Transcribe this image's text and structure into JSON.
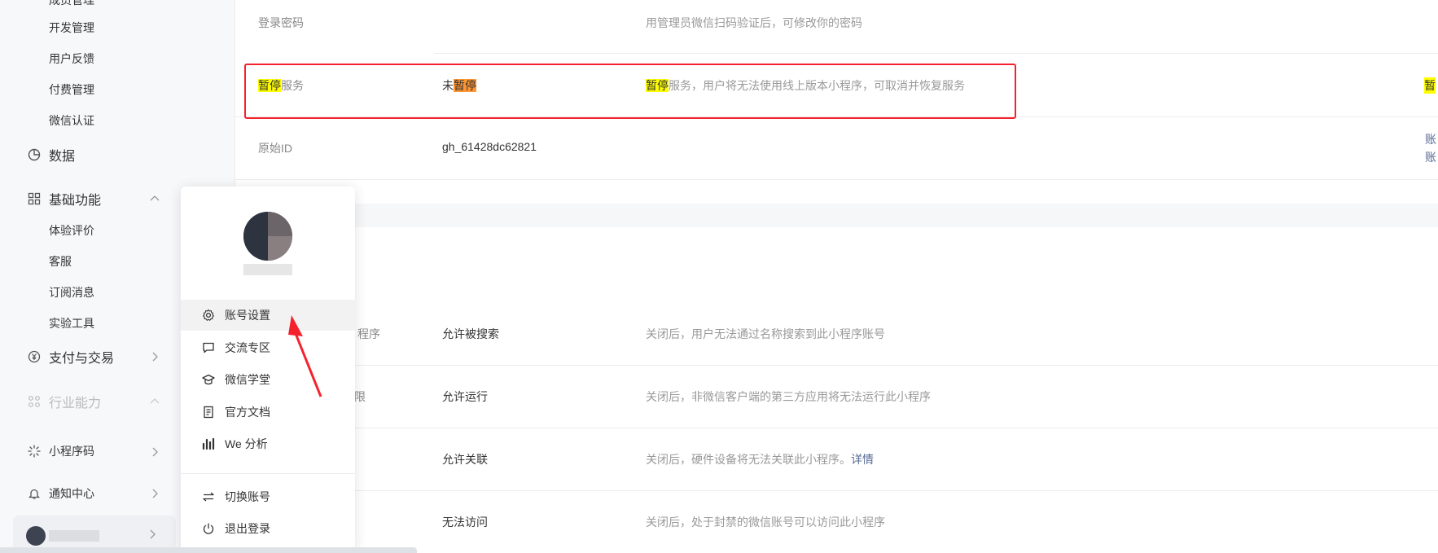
{
  "sidebar": {
    "partial_top_label": "成员管理",
    "sub_items_top": [
      "开发管理",
      "用户反馈",
      "付费管理",
      "微信认证"
    ],
    "data_section": {
      "label": "数据",
      "icon": "pie-chart-icon"
    },
    "basic_section": {
      "label": "基础功能",
      "icon": "grid-icon",
      "expanded": true
    },
    "basic_items": [
      "体验评价",
      "客服",
      "订阅消息",
      "实验工具"
    ],
    "pay_section": {
      "label": "支付与交易",
      "icon": "yuan-icon"
    },
    "industry_section": {
      "label": "行业能力",
      "icon": "nodes-icon"
    },
    "qrcode_section": {
      "label": "小程序码",
      "icon": "sparkle-icon"
    },
    "notify_section": {
      "label": "通知中心",
      "icon": "bell-icon"
    }
  },
  "rows": {
    "password": {
      "label": "登录密码",
      "desc": "用管理员微信扫码验证后，可修改你的密码"
    },
    "pause": {
      "label_hl": "暂停",
      "label_rest": "服务",
      "value_prefix": "未",
      "value_hl": "暂停",
      "desc_hl": "暂停",
      "desc_rest": "服务，用户将无法使用线上版本小程序，可取消并恢复服务",
      "right_hl": "暂"
    },
    "original_id": {
      "label": "原始ID",
      "value": "gh_61428dc62821",
      "right_1": "账",
      "right_2": "账"
    },
    "search": {
      "label_partial": "程序",
      "value": "允许被搜索",
      "desc": "关闭后，用户无法通过名称搜索到此小程序账号"
    },
    "run": {
      "label_partial": "限",
      "value": "允许运行",
      "desc": "关闭后，非微信客户端的第三方应用将无法运行此小程序"
    },
    "link": {
      "value": "允许关联",
      "desc": "关闭后，硬件设备将无法关联此小程序。",
      "link": "详情"
    },
    "visit": {
      "value": "无法访问",
      "desc": "关闭后，处于封禁的微信账号可以访问此小程序"
    }
  },
  "popup": {
    "items": [
      {
        "label": "账号设置",
        "icon": "gear-icon"
      },
      {
        "label": "交流专区",
        "icon": "chat-icon"
      },
      {
        "label": "微信学堂",
        "icon": "graduation-cap-icon"
      },
      {
        "label": "官方文档",
        "icon": "document-icon"
      },
      {
        "label": "We 分析",
        "icon": "bar-chart-icon"
      }
    ],
    "bottom_items": [
      {
        "label": "切换账号",
        "icon": "switch-icon"
      },
      {
        "label": "退出登录",
        "icon": "power-icon"
      }
    ]
  },
  "colors": {
    "highlight_box": "#f5222d",
    "arrow": "#f5222d",
    "search_highlight": "#ffff00",
    "search_highlight_current": "#ff9632"
  }
}
